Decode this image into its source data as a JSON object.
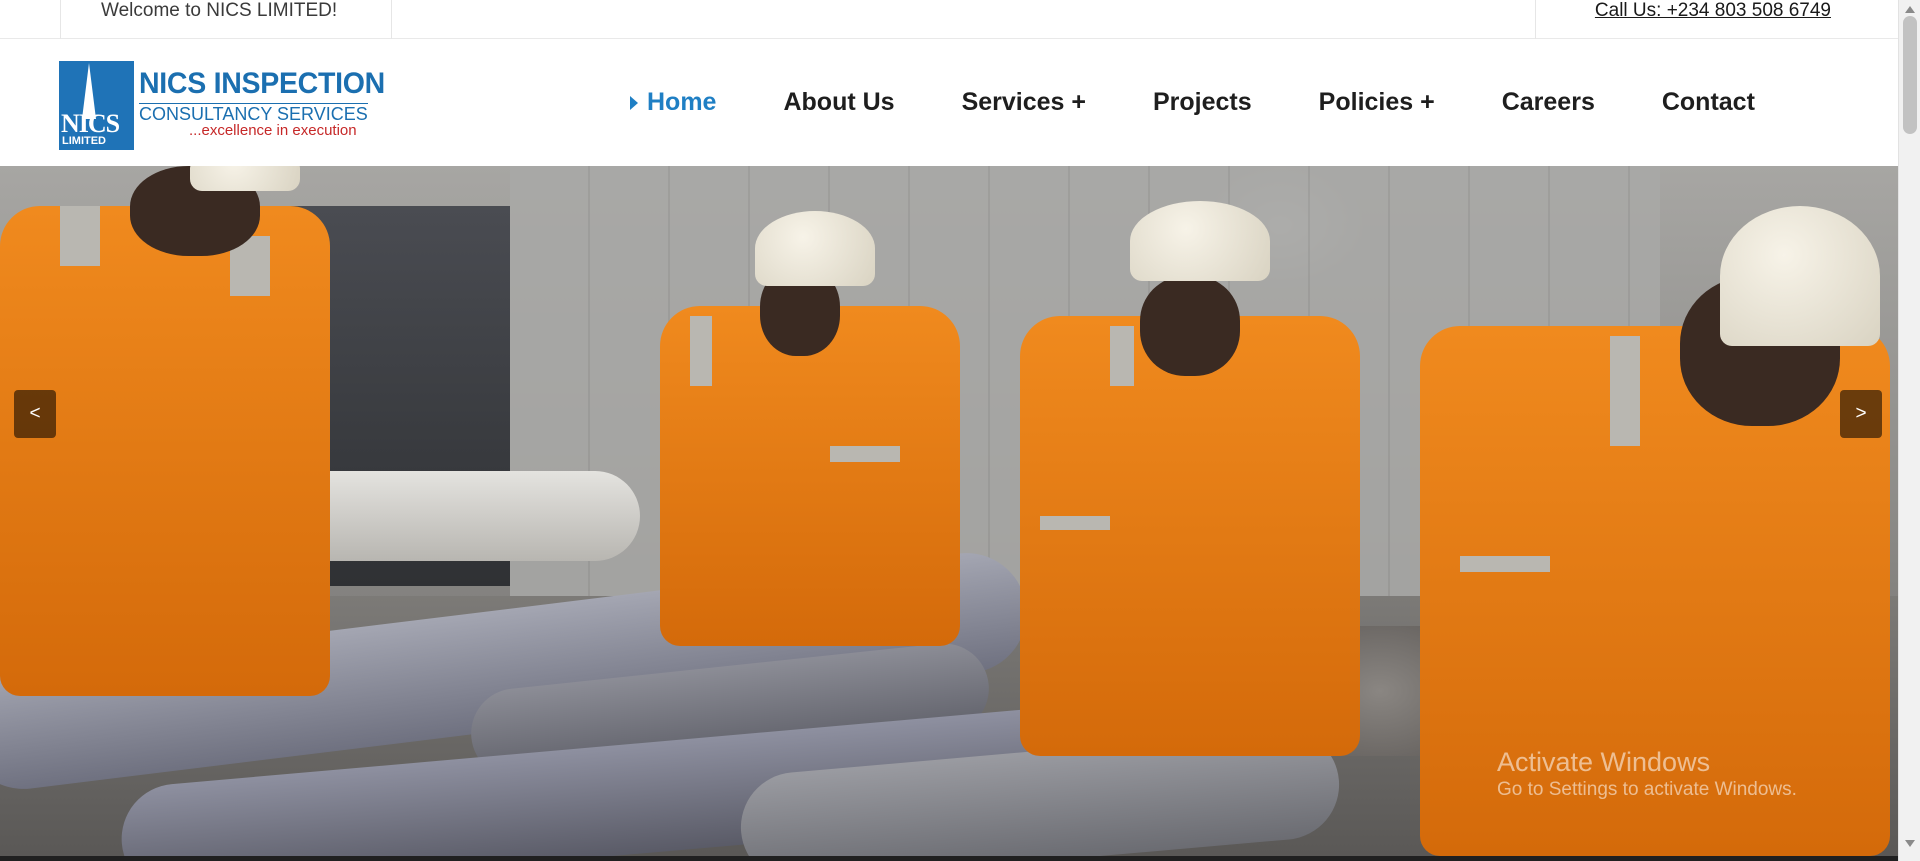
{
  "topbar": {
    "welcome": "Welcome to NICS LIMITED!",
    "phone": "Call Us: +234 803 508 6749"
  },
  "logo": {
    "mark_text": "NICS",
    "mark_sub": "LIMITED",
    "name": "NICS INSPECTION",
    "sub": "CONSULTANCY SERVICES",
    "tagline": "...excellence in execution",
    "colors": {
      "brand_blue": "#1b6fb0",
      "tagline_red": "#c62828"
    }
  },
  "nav": {
    "items": [
      {
        "label": "Home",
        "active": true
      },
      {
        "label": "About Us"
      },
      {
        "label": "Services +"
      },
      {
        "label": "Projects"
      },
      {
        "label": "Policies +"
      },
      {
        "label": "Careers"
      },
      {
        "label": "Contact"
      }
    ],
    "active_color": "#1f7fc4"
  },
  "slider": {
    "prev_label": "<",
    "next_label": ">"
  },
  "watermark": {
    "title": "Activate Windows",
    "subtitle": "Go to Settings to activate Windows."
  }
}
